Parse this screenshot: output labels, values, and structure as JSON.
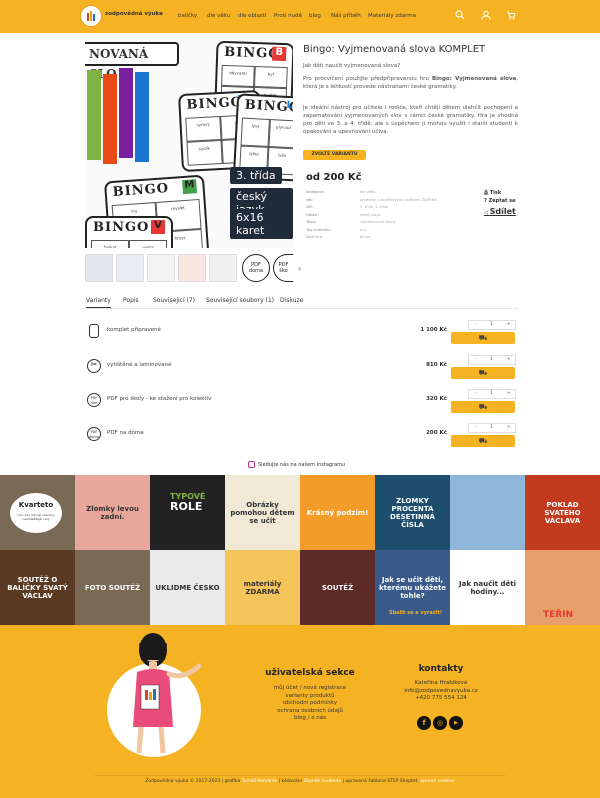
{
  "brand": {
    "name": "zodpovědná výuka"
  },
  "nav": [
    "balíčky",
    "dle věku",
    "dle oblastí",
    "Proti nudě",
    "blog",
    "Náš příběh",
    "Materiály zdarma"
  ],
  "product": {
    "title": "Bingo: Vyjmenovaná slova KOMPLET",
    "subtitle": "Jak děti naučit vyjmenovaná slova?",
    "desc1_a": "Pro procvičení použijte předpřipravenou hru ",
    "desc1_b": "Bingo: Vyjmenovaná slova",
    "desc1_c": ", která je s lehkostí provede nástrahami české gramatiky.",
    "desc2": "Je ideální nástroj pro učitele i rodiče, kteří chtějí dětem ulehčit pochopení a zapamatování vyjmenovaných slov v rámci české gramatiky. Hra je vhodná pro děti ve 3. a 4. třídě, ale s úspěchem ji mohou využít i starší studenti k opakování a upevňování učiva.",
    "variant_button": "ZVOLTE VARIANTU",
    "price": "od 200 Kč",
    "specs": [
      {
        "k": "Kategorie:",
        "v": "dle věku"
      },
      {
        "k": "Věk:",
        "v": "produkty s doplňkovými službami ŽDÁRNA"
      },
      {
        "k": "Věk:",
        "v": "3. třída, 4. třída"
      },
      {
        "k": "Oblast:",
        "v": "český jazyk"
      },
      {
        "k": "Téma:",
        "v": "vyjmenovaná slova"
      },
      {
        "k": "Typ materiálu:",
        "v": "hra"
      },
      {
        "k": "Druh hry:",
        "v": "bingo"
      }
    ],
    "actions": [
      "Tisk",
      "Zeptat se",
      "Sdílet"
    ],
    "gallery_tags": [
      "3. třída",
      "český jazyk",
      "6x16 karet"
    ],
    "bingo_word": "BINGO",
    "bingo_letters": [
      "B",
      "L",
      "S",
      "M",
      "V"
    ],
    "banner": "NOVANÁ SLO",
    "thumb_pdf": [
      "PDF",
      "doma",
      "PDF",
      "ško"
    ]
  },
  "tabs": [
    "Varianty",
    "Popis",
    "Související (7)",
    "Související soubory (1)",
    "Diskuze"
  ],
  "variants": [
    {
      "name": "komplet připravené",
      "price": "1 100 Kč",
      "qty": "1"
    },
    {
      "name": "vytištěné a laminované",
      "price": "810 Kč",
      "qty": "1"
    },
    {
      "name": "PDF pro školy - ke stažení pro kolektiv",
      "price": "320 Kč",
      "qty": "1"
    },
    {
      "name": "PDF na doma",
      "price": "200 Kč",
      "qty": "1"
    }
  ],
  "variant_icon_texts": [
    "",
    "",
    "PDF ško",
    "PDF doma"
  ],
  "qty_controls": {
    "minus": "-",
    "plus": "+"
  },
  "instagram": {
    "label": "Sledujte nás na našem Instagramu"
  },
  "posts": [
    {
      "text": "",
      "bg": "#7a6a55"
    },
    {
      "text": "Zlomky levou zadní.",
      "bg": "#e8a79a"
    },
    {
      "text": "",
      "bg": "#222222"
    },
    {
      "text": "Obrázky pomohou dětem se učit",
      "bg": "#f1e9d6"
    },
    {
      "text": "Krásný podzim!",
      "bg": "#f39c2a"
    },
    {
      "text": "ZLOMKY PROCENTA DESETINNÁ ČÍSLA",
      "bg": "#1d4e6e"
    },
    {
      "text": "",
      "bg": "#8fb7d9"
    },
    {
      "text": "POKLAD SVATÉHO VÁCLAVA",
      "bg": "#c23b1f"
    },
    {
      "text": "SOUTĚŽ O BALÍČKY SVATÝ VÁCLAV",
      "bg": "#5a3a22"
    },
    {
      "text": "FOTO SOUTĚŽ",
      "bg": "#7a6a55"
    },
    {
      "text": "UKLIDME ČESKO",
      "bg": "#eaeaea"
    },
    {
      "text": "materiály ZDARMA",
      "bg": "#f5c45a"
    },
    {
      "text": "SOUTĚŽ",
      "bg": "#5d2a2a"
    },
    {
      "text": "Jak se učit děti, kterému ukážete tohle?",
      "bg": "#3a5a8a"
    },
    {
      "text": "Jak naučit děti hodiny...",
      "bg": "#ffffff"
    },
    {
      "text": "",
      "bg": "#e8a06a"
    }
  ],
  "post_extras": {
    "kvarteto": "Kvarteto",
    "kvarteto_sub": "Hra, kde shrnují všechny nejdůležitější roky",
    "role": "ROLE",
    "role_head": "TYPOVÉ",
    "uklidme": "UKLIĎME ČESKO",
    "kp_sub": "Sbalit se a vyrazit!",
    "teti": "TEŘIN"
  },
  "footer": {
    "sec1_title": "uživatelská sekce",
    "sec1_links": [
      "můj účet / nová registrace",
      "varianty produktů",
      "obchodní podmínky",
      "ochrana osobních údajů",
      "blog / o nás"
    ],
    "sec2_title": "kontakty",
    "sec2_lines": [
      "Kateřina Hrabíková",
      "info@zodpovednavyuka.cz",
      "+420 775 554 124"
    ],
    "social": [
      "f",
      "◎",
      "▶"
    ],
    "copy_a": "Zodpovědná výuka © 2017-2023 | grafika ",
    "copy_b": "Tomáš Komárek",
    "copy_c": " | kódování ",
    "copy_d": "Zbyněk Svoboda",
    "copy_e": " | upravená šablona STEP Shoptet, ",
    "copy_f": "upravit cookies"
  },
  "colors": {
    "accent": "#f5b324",
    "dark": "#1f2b3a"
  }
}
